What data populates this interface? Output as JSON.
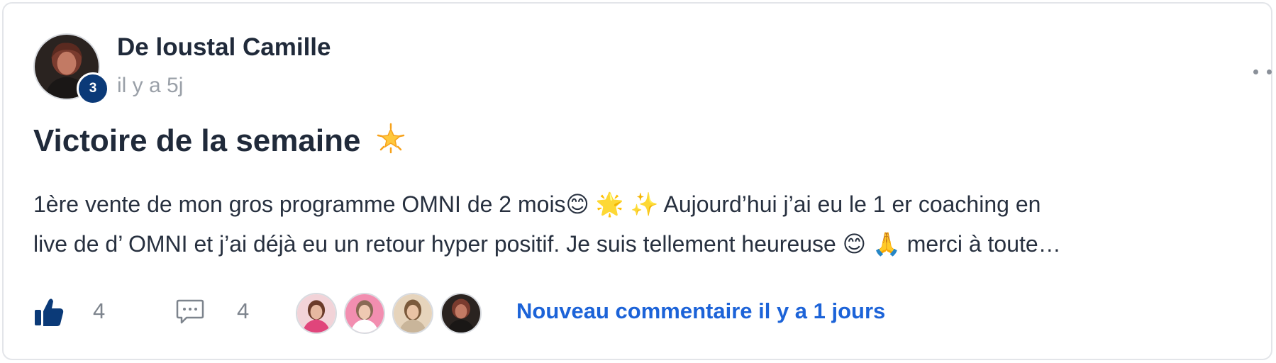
{
  "post": {
    "author": {
      "name": "De loustal Camille",
      "level": "3"
    },
    "timestamp": "il y a 5j",
    "title": "Victoire de la semaine",
    "title_emoji": "glowing-star",
    "body_line_1": "1ère vente de mon gros programme OMNI de 2 mois😊 🌟 ✨ Aujourd’hui j’ai eu le 1 er coaching en",
    "body_line_2": "live de d’ OMNI et j’ai déjà eu un retour hyper positif. Je suis tellement heureuse 😊 🙏 merci à toute…",
    "likes": "4",
    "comments": "4",
    "new_comment_text": "Nouveau commentaire il y a 1 jours"
  },
  "icons": {
    "more": "more-horizontal-icon",
    "like": "thumbs-up-icon",
    "comment": "comment-bubble-icon"
  },
  "colors": {
    "brand": "#0b3a78",
    "link": "#1c63d8",
    "text": "#202a3a",
    "muted": "#9aa0a8",
    "border": "#e3e5e9"
  }
}
